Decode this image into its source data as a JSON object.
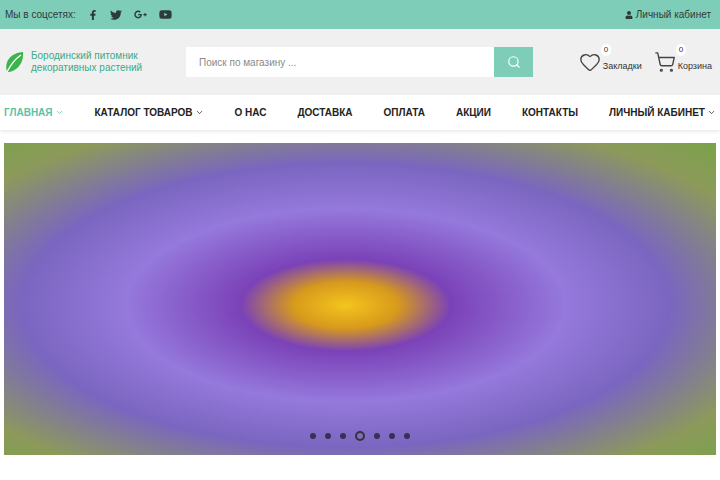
{
  "top_bar": {
    "social_label": "Мы в соцсетях:",
    "account_link": "Личный кабинет"
  },
  "logo": {
    "line1": "Бородинский питомник",
    "line2": "декоративных растений"
  },
  "search": {
    "placeholder": "Поиск по магазину ..."
  },
  "bookmarks": {
    "count": "0",
    "label": "Закладки"
  },
  "cart": {
    "count": "0",
    "label": "Корзина"
  },
  "nav": [
    {
      "label": "ГЛАВНАЯ",
      "selected": true,
      "dropdown": true
    },
    {
      "label": "КАТАЛОГ ТОВАРОВ",
      "selected": false,
      "dropdown": true
    },
    {
      "label": "О НАС",
      "selected": false,
      "dropdown": false
    },
    {
      "label": "ДОСТАВКА",
      "selected": false,
      "dropdown": false
    },
    {
      "label": "ОПЛАТА",
      "selected": false,
      "dropdown": false
    },
    {
      "label": "АКЦИИ",
      "selected": false,
      "dropdown": false
    },
    {
      "label": "КОНТАКТЫ",
      "selected": false,
      "dropdown": false
    },
    {
      "label": "ЛИЧНЫЙ КАБИНЕТ",
      "selected": false,
      "dropdown": true
    }
  ],
  "slider": {
    "dots": [
      {
        "selected": false
      },
      {
        "selected": false
      },
      {
        "selected": false
      },
      {
        "selected": true
      },
      {
        "selected": false
      },
      {
        "selected": false
      },
      {
        "selected": false
      }
    ]
  }
}
